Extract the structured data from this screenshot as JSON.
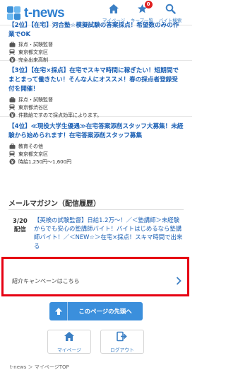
{
  "header": {
    "logo_text": "t-news",
    "nav": [
      {
        "label": "マイページ",
        "icon": "home-icon"
      },
      {
        "label": "キープ一覧",
        "icon": "star-icon",
        "badge": "0"
      },
      {
        "label": "バイト検索",
        "icon": "search-icon"
      }
    ]
  },
  "jobs": [
    {
      "title": "【2位】【在宅】河合塾☆模擬試験の答案採点！希望数のみの作業でOK",
      "meta": [
        {
          "icon": "briefcase-icon",
          "text": "採点・試験監督"
        },
        {
          "icon": "train-icon",
          "text": "東京都文京区"
        },
        {
          "icon": "yen-icon",
          "text": "完全出来高制"
        }
      ]
    },
    {
      "title": "【3位】【在宅×採点】在宅でスキマ時間に稼ぎたい！短期間でまとまって働きたい！そんな人にオススメ！春の採点者登録受付を開催！",
      "meta": [
        {
          "icon": "briefcase-icon",
          "text": "採点・試験監督"
        },
        {
          "icon": "train-icon",
          "text": "東京都渋谷区"
        },
        {
          "icon": "yen-icon",
          "text": "件数給ですので採点効率によります。"
        }
      ]
    },
    {
      "title": "【4位】≪現役大学生優遇≫在宅答案添削スタッフ大募集！未経験から始められます！在宅答案添削スタッフ募集",
      "meta": [
        {
          "icon": "briefcase-icon",
          "text": "教育その他"
        },
        {
          "icon": "train-icon",
          "text": "東京都文京区"
        },
        {
          "icon": "yen-icon",
          "text": "時給1,250円～1,600円"
        }
      ]
    }
  ],
  "magazine": {
    "title": "メールマガジン（配信履歴）",
    "date": "3/20",
    "date_sub": "配信",
    "link": "【英検の試験監督】日給1.2万〜！／＜塾講師＞未経験からでも安心の塾講師バイト！バイトはじめるなら塾講師バイト！／＜NEW☆＞在宅×採点！スキマ時間で出来る"
  },
  "campaign": {
    "label": "紹介キャンペーンはこちら"
  },
  "back_to_top": {
    "label": "このページの先頭へ"
  },
  "footer": {
    "mypage_label": "マイページ",
    "logout_label": "ログアウト"
  },
  "breadcrumb": {
    "text": "t-news ＞ マイページTOP"
  },
  "colors": {
    "link": "#1a5fb4",
    "brand": "#3b8fdc",
    "highlight_border": "#e60012",
    "badge": "#e02020"
  }
}
